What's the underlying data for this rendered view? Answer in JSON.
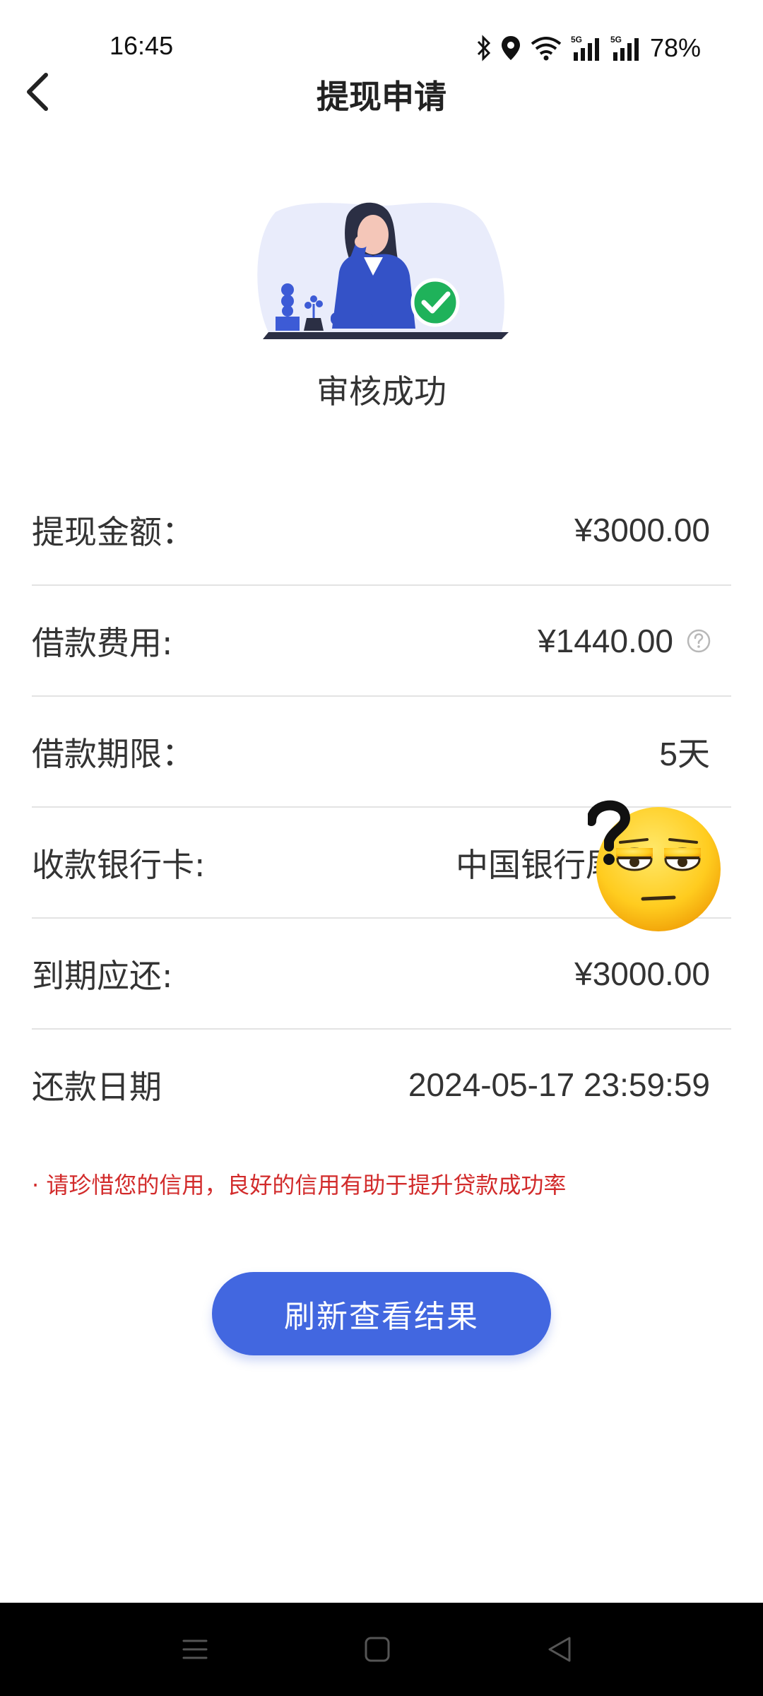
{
  "status_bar": {
    "time": "16:45",
    "battery": "78%",
    "icons": [
      "bluetooth-icon",
      "location-icon",
      "wifi-icon",
      "signal-5g-icon",
      "signal-5g-icon",
      "battery-text"
    ]
  },
  "nav": {
    "back_icon": "chevron-left-icon",
    "title": "提现申请"
  },
  "result": {
    "title": "审核成功",
    "illustration": "woman-at-desk-with-checkmark"
  },
  "rows": [
    {
      "label": "提现金额：",
      "value": "¥3000.00"
    },
    {
      "label": "借款费用:",
      "value": "¥1440.00",
      "help_icon": "question-circle-icon"
    },
    {
      "label": "借款期限：",
      "value": "5天"
    },
    {
      "label": "收款银行卡:",
      "value": "中国银行尾"
    },
    {
      "label": "到期应还:",
      "value": "¥3000.00"
    },
    {
      "label": "还款日期",
      "value": "2024-05-17 23:59:59"
    }
  ],
  "overlay_sticker": "thinking-emoji-with-question-mark",
  "notice": "· 请珍惜您的信用，良好的信用有助于提升贷款成功率",
  "button": {
    "label": "刷新查看结果"
  },
  "system_nav": [
    "menu-icon",
    "home-icon",
    "back-triangle-icon"
  ],
  "colors": {
    "accent": "#4267e0",
    "success": "#1fb25a",
    "notice": "#d22b2b",
    "illustration_suit": "#3452c7"
  }
}
